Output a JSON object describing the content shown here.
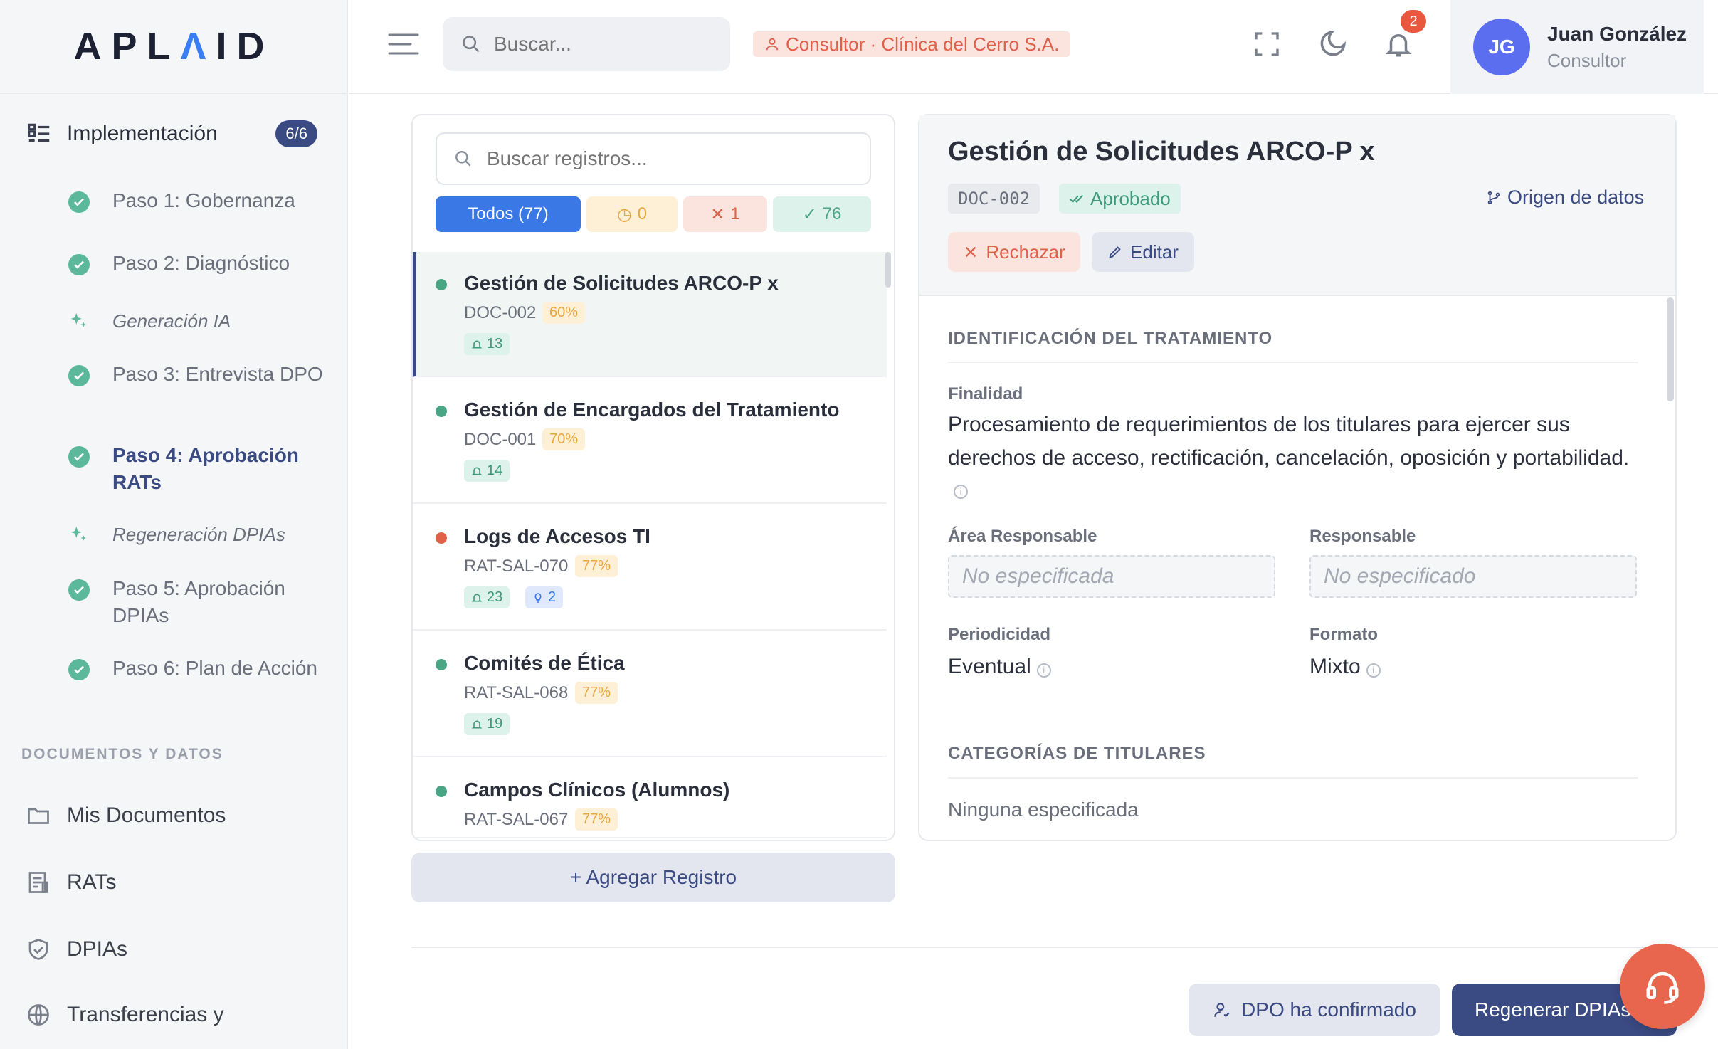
{
  "brand": {
    "logo_prefix": "APL",
    "logo_accent": "Λ",
    "logo_suffix": "ID"
  },
  "sidebar": {
    "section": {
      "label": "Implementación",
      "badge": "6/6"
    },
    "steps": [
      {
        "label": "Paso 1: Gobernanza",
        "icon": "check-circle-icon"
      },
      {
        "label": "Paso 2: Diagnóstico",
        "icon": "check-circle-icon"
      },
      {
        "label": "Generación IA",
        "icon": "sparkle-icon"
      },
      {
        "label": "Paso 3: Entrevista DPO",
        "icon": "check-circle-icon"
      },
      {
        "label": "Paso 4: Aprobación RATs",
        "icon": "check-circle-icon",
        "active": true
      },
      {
        "label": "Regeneración DPIAs",
        "icon": "sparkle-icon"
      },
      {
        "label": "Paso 5: Aprobación DPIAs",
        "icon": "check-circle-icon"
      },
      {
        "label": "Paso 6: Plan de Acción",
        "icon": "check-circle-icon"
      }
    ],
    "docs_title": "DOCUMENTOS Y DATOS",
    "docs": [
      {
        "label": "Mis Documentos",
        "icon": "folder-icon"
      },
      {
        "label": "RATs",
        "icon": "document-list-icon"
      },
      {
        "label": "DPIAs",
        "icon": "shield-icon"
      },
      {
        "label": "Transferencias y",
        "icon": "globe-icon"
      }
    ]
  },
  "header": {
    "search_placeholder": "Buscar...",
    "role_chip": "Consultor · Clínica del Cerro S.A.",
    "notifications_count": "2",
    "user": {
      "initials": "JG",
      "name": "Juan González",
      "role": "Consultor"
    }
  },
  "list": {
    "search_placeholder": "Buscar registros...",
    "filters": {
      "all": "Todos (77)",
      "pending": "0",
      "rejected": "1",
      "approved": "76"
    },
    "records": [
      {
        "title": "Gestión de Solicitudes ARCO-P x",
        "code": "DOC-002",
        "pct": "60%",
        "chips": [
          {
            "type": "g",
            "icon": "bell-icon",
            "value": "13"
          }
        ],
        "status_color": "#4aa585",
        "selected": true
      },
      {
        "title": "Gestión de Encargados del Tratamiento",
        "code": "DOC-001",
        "pct": "70%",
        "chips": [
          {
            "type": "g",
            "icon": "bell-icon",
            "value": "14"
          }
        ],
        "status_color": "#4aa585"
      },
      {
        "title": "Logs de Accesos TI",
        "code": "RAT-SAL-070",
        "pct": "77%",
        "chips": [
          {
            "type": "g",
            "icon": "bell-icon",
            "value": "23"
          },
          {
            "type": "b",
            "icon": "bulb-icon",
            "value": "2"
          }
        ],
        "status_color": "#e0604a"
      },
      {
        "title": "Comités de Ética",
        "code": "RAT-SAL-068",
        "pct": "77%",
        "chips": [
          {
            "type": "g",
            "icon": "bell-icon",
            "value": "19"
          }
        ],
        "status_color": "#4aa585"
      },
      {
        "title": "Campos Clínicos (Alumnos)",
        "code": "RAT-SAL-067",
        "pct": "77%",
        "chips": [],
        "status_color": "#4aa585"
      }
    ],
    "add_button": "+ Agregar Registro"
  },
  "detail": {
    "title": "Gestión de Solicitudes ARCO-P x",
    "code": "DOC-002",
    "status": "Aprobado",
    "origin_link": "Origen de datos",
    "reject_label": "Rechazar",
    "edit_label": "Editar",
    "section1_title": "IDENTIFICACIÓN DEL TRATAMIENTO",
    "finalidad_label": "Finalidad",
    "finalidad_value": "Procesamiento de requerimientos de los titulares para ejercer sus derechos de acceso, rectificación, cancelación, oposición y portabilidad.",
    "area_label": "Área Responsable",
    "area_value": "No especificada",
    "responsable_label": "Responsable",
    "responsable_value": "No especificado",
    "periodicidad_label": "Periodicidad",
    "periodicidad_value": "Eventual",
    "formato_label": "Formato",
    "formato_value": "Mixto",
    "section2_title": "CATEGORÍAS DE TITULARES",
    "categorias_value": "Ninguna especificada"
  },
  "footer": {
    "dpo_button": "DPO ha confirmado",
    "regen_button": "Regenerar DPIAs"
  },
  "colors": {
    "primary": "#3a4a82",
    "accent_blue": "#3a78e6",
    "success": "#4aa585",
    "danger": "#e0604a",
    "warning": "#e8a640"
  }
}
